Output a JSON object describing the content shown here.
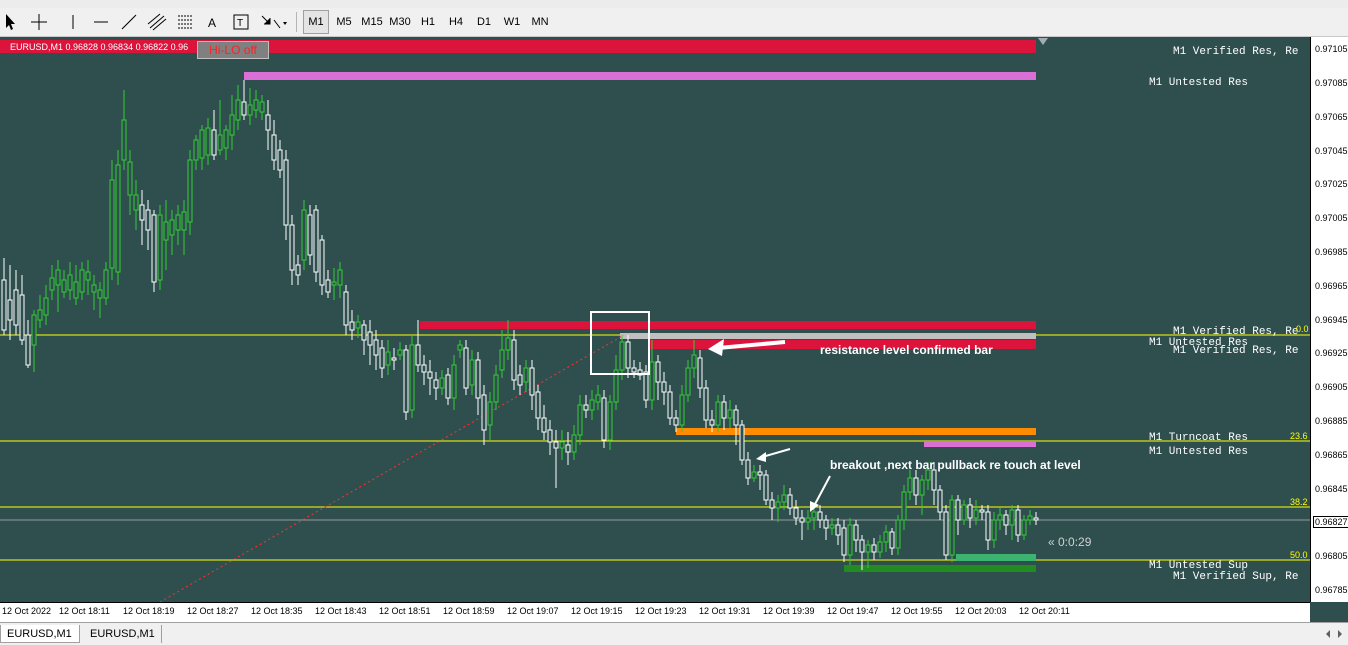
{
  "toolbar": {
    "timeframes": [
      "M1",
      "M5",
      "M15",
      "M30",
      "H1",
      "H4",
      "D1",
      "W1",
      "MN"
    ],
    "selected": "M1"
  },
  "chart": {
    "symbol_info": "EURUSD,M1  0.96828 0.96834 0.96822 0.96",
    "hilo_button": "Hi-LO off",
    "timer": "« 0:0:29",
    "current_price": "0.96827",
    "prices": [
      "0.97105",
      "0.97085",
      "0.97065",
      "0.97045",
      "0.97025",
      "0.97005",
      "0.96985",
      "0.96965",
      "0.96945",
      "0.96925",
      "0.96905",
      "0.96885",
      "0.96865",
      "0.96845",
      "0.96825",
      "0.96805",
      "0.96785"
    ],
    "times": [
      "12 Oct 2022",
      "12 Oct 18:11",
      "12 Oct 18:19",
      "12 Oct 18:27",
      "12 Oct 18:35",
      "12 Oct 18:43",
      "12 Oct 18:51",
      "12 Oct 18:59",
      "12 Oct 19:07",
      "12 Oct 19:15",
      "12 Oct 19:23",
      "12 Oct 19:31",
      "12 Oct 19:39",
      "12 Oct 19:47",
      "12 Oct 19:55",
      "12 Oct 20:03",
      "12 Oct 20:11"
    ],
    "zones": {
      "top_res": "M1 Verified Res, Re",
      "untested_res_top": "M1 Untested Res",
      "verified_res_a": "M1 Verified Res, Re",
      "untested_res_mid": "M1 Untested Res",
      "verified_res_b": "M1 Verified Res, Re",
      "turncoat_res": "M1 Turncoat Res",
      "untested_res_low": "M1 Untested Res",
      "untested_sup": "M1 Untested Sup",
      "verified_sup": "M1 Verified Sup, Re"
    },
    "fib_levels": [
      "0.0",
      "23.6",
      "38.2",
      "50.0"
    ],
    "annotations": {
      "resistance": "resistance level confirmed bar",
      "breakout": "breakout ,next bar pullback re touch at level"
    }
  },
  "tabs": [
    "EURUSD,M1",
    "EURUSD,M1"
  ],
  "colors": {
    "background": "#2f4f4f",
    "resistance": "#dc143c",
    "untested": "#da70d6",
    "turncoat": "#ff8c00",
    "support": "#228b22",
    "fib": "#ffff00",
    "bull": "#32cd32",
    "bear": "#ffffff"
  }
}
